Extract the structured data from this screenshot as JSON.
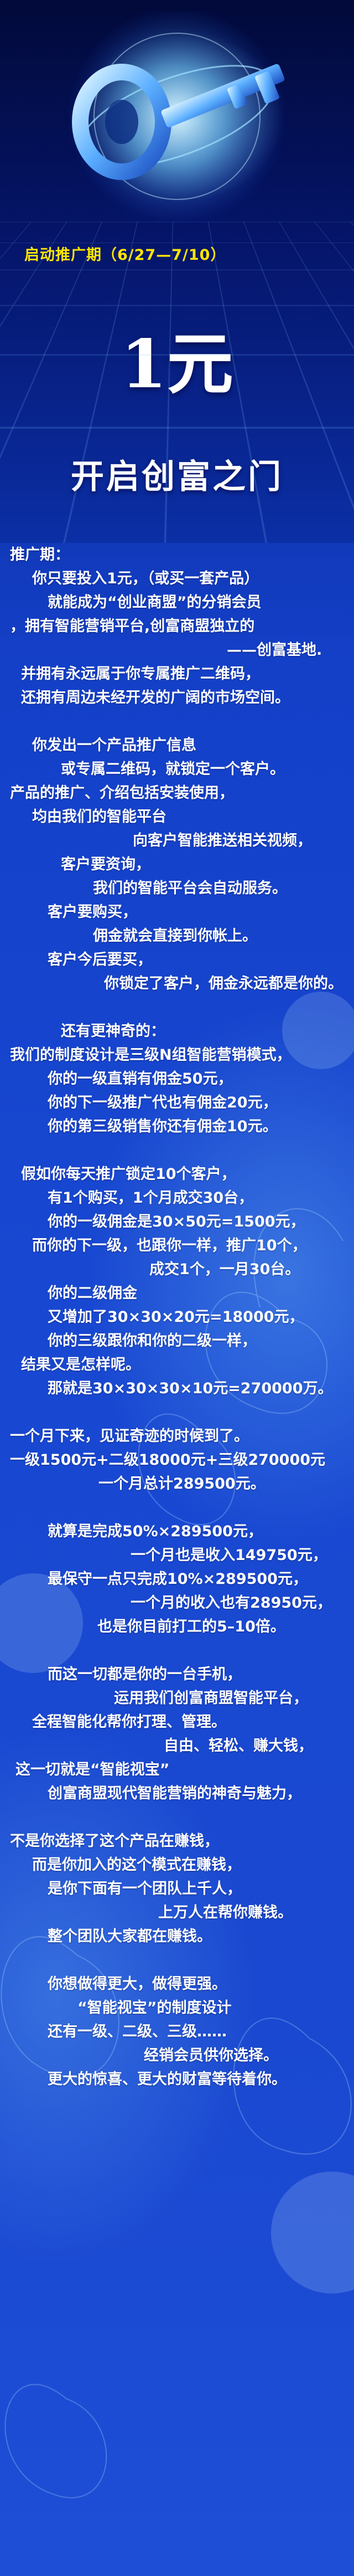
{
  "header": {
    "launch_period": "启动推广期（6/27—7/10）",
    "price": "1元",
    "slogan": "开启创富之门"
  },
  "colors": {
    "accent_yellow": "#ffe600",
    "text": "#ffffff",
    "background": "#1a48d0"
  },
  "paragraphs": [
    [
      {
        "indent": 18,
        "text": "推广期："
      },
      {
        "indent": 58,
        "text": "你只要投入1元，（或买一套产品）"
      },
      {
        "indent": 86,
        "text": "就能成为“创业商盟”的分销会员"
      },
      {
        "indent": 18,
        "text": "，拥有智能营销平台,创富商盟独立的"
      },
      {
        "indent": 410,
        "text": "——创富基地."
      },
      {
        "indent": 38,
        "text": "并拥有永远属于你专属推广二维码，"
      },
      {
        "indent": 38,
        "text": "还拥有周边未经开发的广阔的市场空间。"
      }
    ],
    [
      {
        "indent": 58,
        "text": "你发出一个产品推广信息"
      },
      {
        "indent": 110,
        "text": "或专属二维码，就锁定一个客户。"
      },
      {
        "indent": 18,
        "text": "产品的推广、介绍包括安装使用，"
      },
      {
        "indent": 58,
        "text": "均由我们的智能平台"
      },
      {
        "indent": 240,
        "text": "向客户智能推送相关视频，"
      },
      {
        "indent": 110,
        "text": "客户要资询，"
      },
      {
        "indent": 168,
        "text": "我们的智能平台会自动服务。"
      },
      {
        "indent": 86,
        "text": "客户要购买，"
      },
      {
        "indent": 168,
        "text": "佣金就会直接到你帐上。"
      },
      {
        "indent": 86,
        "text": "客户今后要买，"
      },
      {
        "indent": 188,
        "text": "你锁定了客户，佣金永远都是你的。"
      }
    ],
    [
      {
        "indent": 110,
        "text": "还有更神奇的："
      },
      {
        "indent": 18,
        "text": "我们的制度设计是三级N组智能营销模式，"
      },
      {
        "indent": 86,
        "text": "你的一级直销有佣金50元，"
      },
      {
        "indent": 86,
        "text": "你的下一级推广代也有佣金20元，"
      },
      {
        "indent": 86,
        "text": "你的第三级销售你还有佣金10元。"
      }
    ],
    [
      {
        "indent": 38,
        "text": "假如你每天推广锁定10个客户，"
      },
      {
        "indent": 86,
        "text": "有1个购买，1个月成交30台，"
      },
      {
        "indent": 86,
        "text": "你的一级佣金是30×50元=1500元，"
      },
      {
        "indent": 58,
        "text": "而你的下一级，也跟你一样，推广10个，"
      },
      {
        "indent": 270,
        "text": "成交1个，一月30台。"
      },
      {
        "indent": 86,
        "text": "你的二级佣金"
      },
      {
        "indent": 86,
        "text": "又增加了30×30×20元=18000元，"
      },
      {
        "indent": 86,
        "text": "你的三级跟你和你的二级一样，"
      },
      {
        "indent": 38,
        "text": "结果又是怎样呢。"
      },
      {
        "indent": 86,
        "text": "那就是30×30×30×10元=270000万。"
      }
    ],
    [
      {
        "indent": 18,
        "text": "一个月下来，见证奇迹的时候到了。"
      },
      {
        "indent": 18,
        "text": "一级1500元+二级18000元+三级270000元"
      },
      {
        "indent": 178,
        "text": "一个月总计289500元。"
      }
    ],
    [
      {
        "indent": 86,
        "text": "就算是完成50%×289500元，"
      },
      {
        "indent": 236,
        "text": "一个月也是收入149750元，"
      },
      {
        "indent": 86,
        "text": "最保守一点只完成10%×289500元，"
      },
      {
        "indent": 236,
        "text": "一个月的收入也有28950元，"
      },
      {
        "indent": 176,
        "text": "也是你目前打工的5–10倍。"
      }
    ],
    [
      {
        "indent": 86,
        "text": "而这一切都是你的一台手机，"
      },
      {
        "indent": 206,
        "text": "运用我们创富商盟智能平台，"
      },
      {
        "indent": 58,
        "text": "全程智能化帮你打理、管理。"
      },
      {
        "indent": 296,
        "text": "自由、轻松、赚大钱，"
      },
      {
        "indent": 28,
        "text": "这一切就是“智能视宝”"
      },
      {
        "indent": 86,
        "text": "创富商盟现代智能营销的神奇与魅力，"
      }
    ],
    [
      {
        "indent": 18,
        "text": "不是你选择了这个产品在赚钱，"
      },
      {
        "indent": 58,
        "text": "而是你加入的这个模式在赚钱，"
      },
      {
        "indent": 86,
        "text": "是你下面有一个团队上千人，"
      },
      {
        "indent": 286,
        "text": "上万人在帮你赚钱。"
      },
      {
        "indent": 86,
        "text": "整个团队大家都在赚钱。"
      }
    ],
    [
      {
        "indent": 86,
        "text": "你想做得更大，做得更强。"
      },
      {
        "indent": 140,
        "text": "“智能视宝”的制度设计"
      },
      {
        "indent": 86,
        "text": "还有一级、二级、三级……"
      },
      {
        "indent": 260,
        "text": "经销会员供你选择。"
      },
      {
        "indent": 86,
        "text": "更大的惊喜、更大的财富等待着你。"
      }
    ]
  ]
}
